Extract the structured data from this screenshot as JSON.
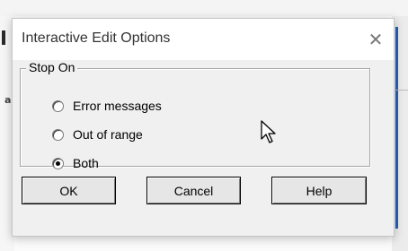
{
  "window": {
    "title": "Interactive Edit Options",
    "close_glyph": "✕"
  },
  "group": {
    "legend": "Stop On",
    "options": [
      {
        "label": "Error messages",
        "checked": false
      },
      {
        "label": "Out of range",
        "checked": false
      },
      {
        "label": "Both",
        "checked": true
      }
    ]
  },
  "buttons": {
    "ok": "OK",
    "cancel": "Cancel",
    "help": "Help"
  },
  "background": {
    "left_glyph": "a"
  },
  "icons": {
    "cursor": "arrow-cursor-icon",
    "close": "close-icon"
  }
}
